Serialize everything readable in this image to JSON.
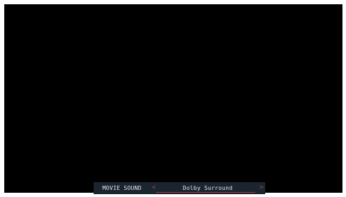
{
  "osd": {
    "setting_label": "MOVIE SOUND",
    "value": "Dolby Surround",
    "prev_glyph": "<",
    "next_glyph": ">",
    "icons": {
      "prev": "chevron-left-icon",
      "next": "chevron-right-icon"
    },
    "colors": {
      "background": "#000000",
      "bar": "#1b2530",
      "text": "#e4e8ec",
      "accent": "#c23a3a"
    }
  }
}
